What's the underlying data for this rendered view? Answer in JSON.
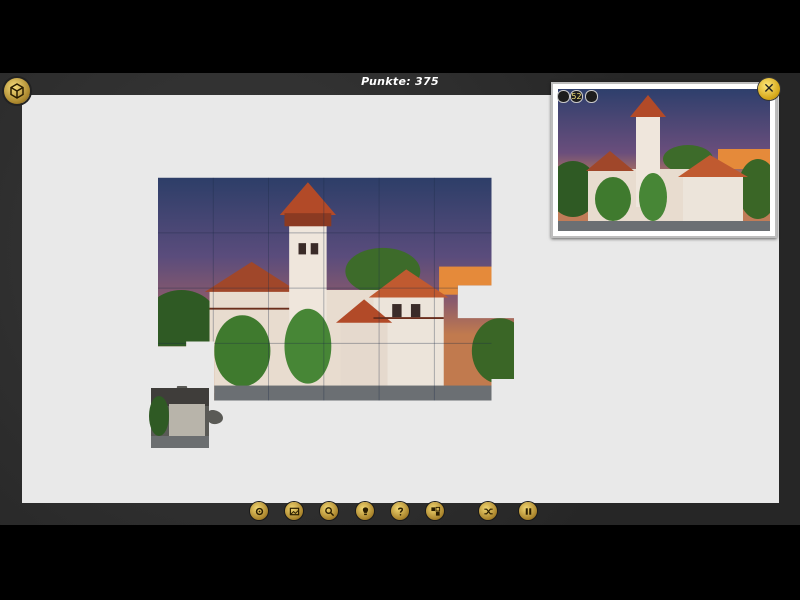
{
  "hud": {
    "score_label": "Punkte: 375",
    "score_value": 375
  },
  "menu": {
    "icon": "cube-menu-icon"
  },
  "preview": {
    "close_label": "✕",
    "badges": [
      "",
      "52",
      ""
    ]
  },
  "toolbar": {
    "buttons": [
      {
        "name": "settings-gear",
        "icon": "gear-icon"
      },
      {
        "name": "show-preview",
        "icon": "picture-icon"
      },
      {
        "name": "zoom",
        "icon": "magnifier-icon"
      },
      {
        "name": "hint",
        "icon": "lightbulb-icon"
      },
      {
        "name": "help",
        "icon": "question-icon"
      },
      {
        "name": "sort-pieces",
        "icon": "pieces-icon"
      },
      {
        "name": "shuffle",
        "icon": "shuffle-icon"
      },
      {
        "name": "pause",
        "icon": "pause-icon"
      }
    ]
  },
  "colors": {
    "board": "#e9e9e9",
    "frame": "#2d2d2d",
    "gold": "#d3a415"
  }
}
